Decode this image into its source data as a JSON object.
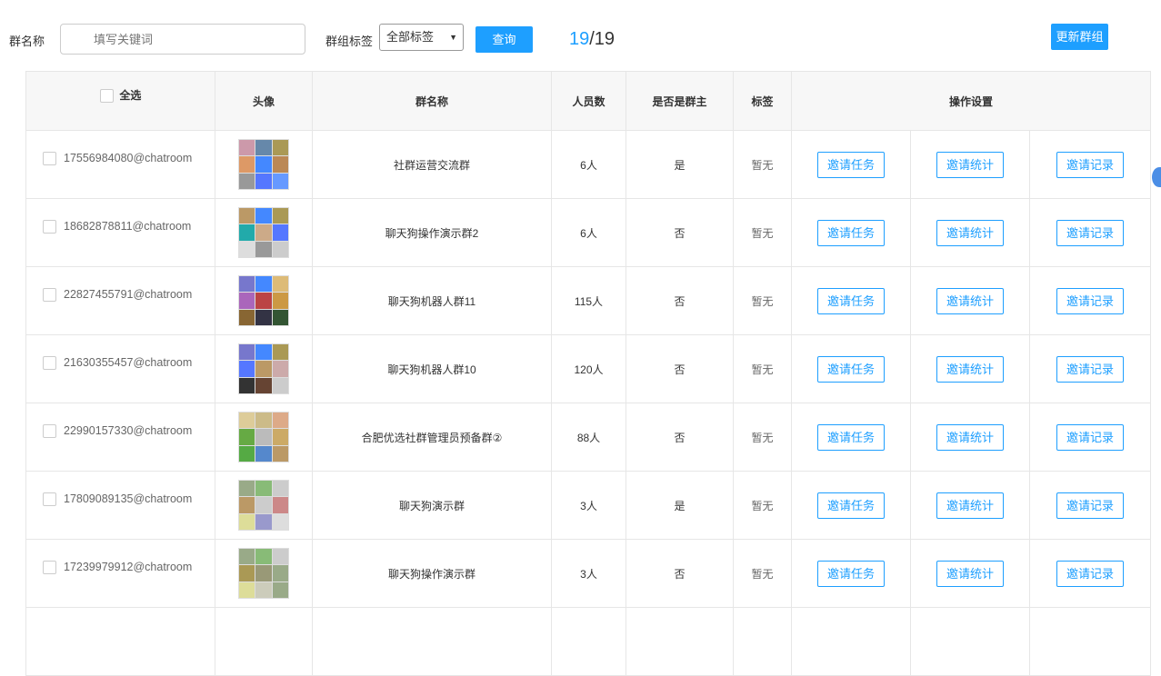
{
  "filters": {
    "name_label": "群名称",
    "keyword_placeholder": "填写关键词",
    "tag_label": "群组标签",
    "tag_selected": "全部标签",
    "query_button": "查询",
    "count_current": "19",
    "count_total": "/19",
    "update_button": "更新群组"
  },
  "table": {
    "headers": {
      "select_all": "全选",
      "avatar": "头像",
      "name": "群名称",
      "members": "人员数",
      "is_owner": "是否是群主",
      "tag": "标签",
      "actions": "操作设置"
    },
    "action_labels": {
      "task": "邀请任务",
      "stats": "邀请统计",
      "records": "邀请记录"
    },
    "rows": [
      {
        "id": "17556984080@chatroom",
        "name": "社群运营交流群",
        "members": "6人",
        "is_owner": "是",
        "tag": "暂无",
        "colors": [
          "#c9a",
          "#68a",
          "#a95",
          "#d96",
          "#48f",
          "#b85",
          "#999",
          "#57f",
          "#69f"
        ]
      },
      {
        "id": "18682878811@chatroom",
        "name": "聊天狗操作演示群2",
        "members": "6人",
        "is_owner": "否",
        "tag": "暂无",
        "colors": [
          "#b96",
          "#48f",
          "#a95",
          "#2aa",
          "#ca8",
          "#57f",
          "#ddd",
          "#999",
          "#ccc"
        ]
      },
      {
        "id": "22827455791@chatroom",
        "name": "聊天狗机器人群11",
        "members": "115人",
        "is_owner": "否",
        "tag": "暂无",
        "colors": [
          "#77c",
          "#48f",
          "#db7",
          "#a6b",
          "#b44",
          "#c94",
          "#863",
          "#334",
          "#353"
        ]
      },
      {
        "id": "21630355457@chatroom",
        "name": "聊天狗机器人群10",
        "members": "120人",
        "is_owner": "否",
        "tag": "暂无",
        "colors": [
          "#77c",
          "#48f",
          "#a95",
          "#57f",
          "#b96",
          "#caa",
          "#333",
          "#643",
          "#ccc"
        ]
      },
      {
        "id": "22990157330@chatroom",
        "name": "合肥优选社群管理员预备群②",
        "members": "88人",
        "is_owner": "否",
        "tag": "暂无",
        "colors": [
          "#dc9",
          "#cb8",
          "#da8",
          "#6a4",
          "#bbb",
          "#ca6",
          "#5a4",
          "#58c",
          "#b96"
        ]
      },
      {
        "id": "17809089135@chatroom",
        "name": "聊天狗演示群",
        "members": "3人",
        "is_owner": "是",
        "tag": "暂无",
        "colors": [
          "#9a8",
          "#8b7",
          "#ccc",
          "#b96",
          "#ccc",
          "#c88",
          "#dd9",
          "#99c",
          "#ddd"
        ]
      },
      {
        "id": "17239979912@chatroom",
        "name": "聊天狗操作演示群",
        "members": "3人",
        "is_owner": "否",
        "tag": "暂无",
        "colors": [
          "#9a8",
          "#8b7",
          "#ccc",
          "#a95",
          "#997",
          "#9a8",
          "#dd9",
          "#ccb",
          "#9a8"
        ]
      }
    ]
  }
}
